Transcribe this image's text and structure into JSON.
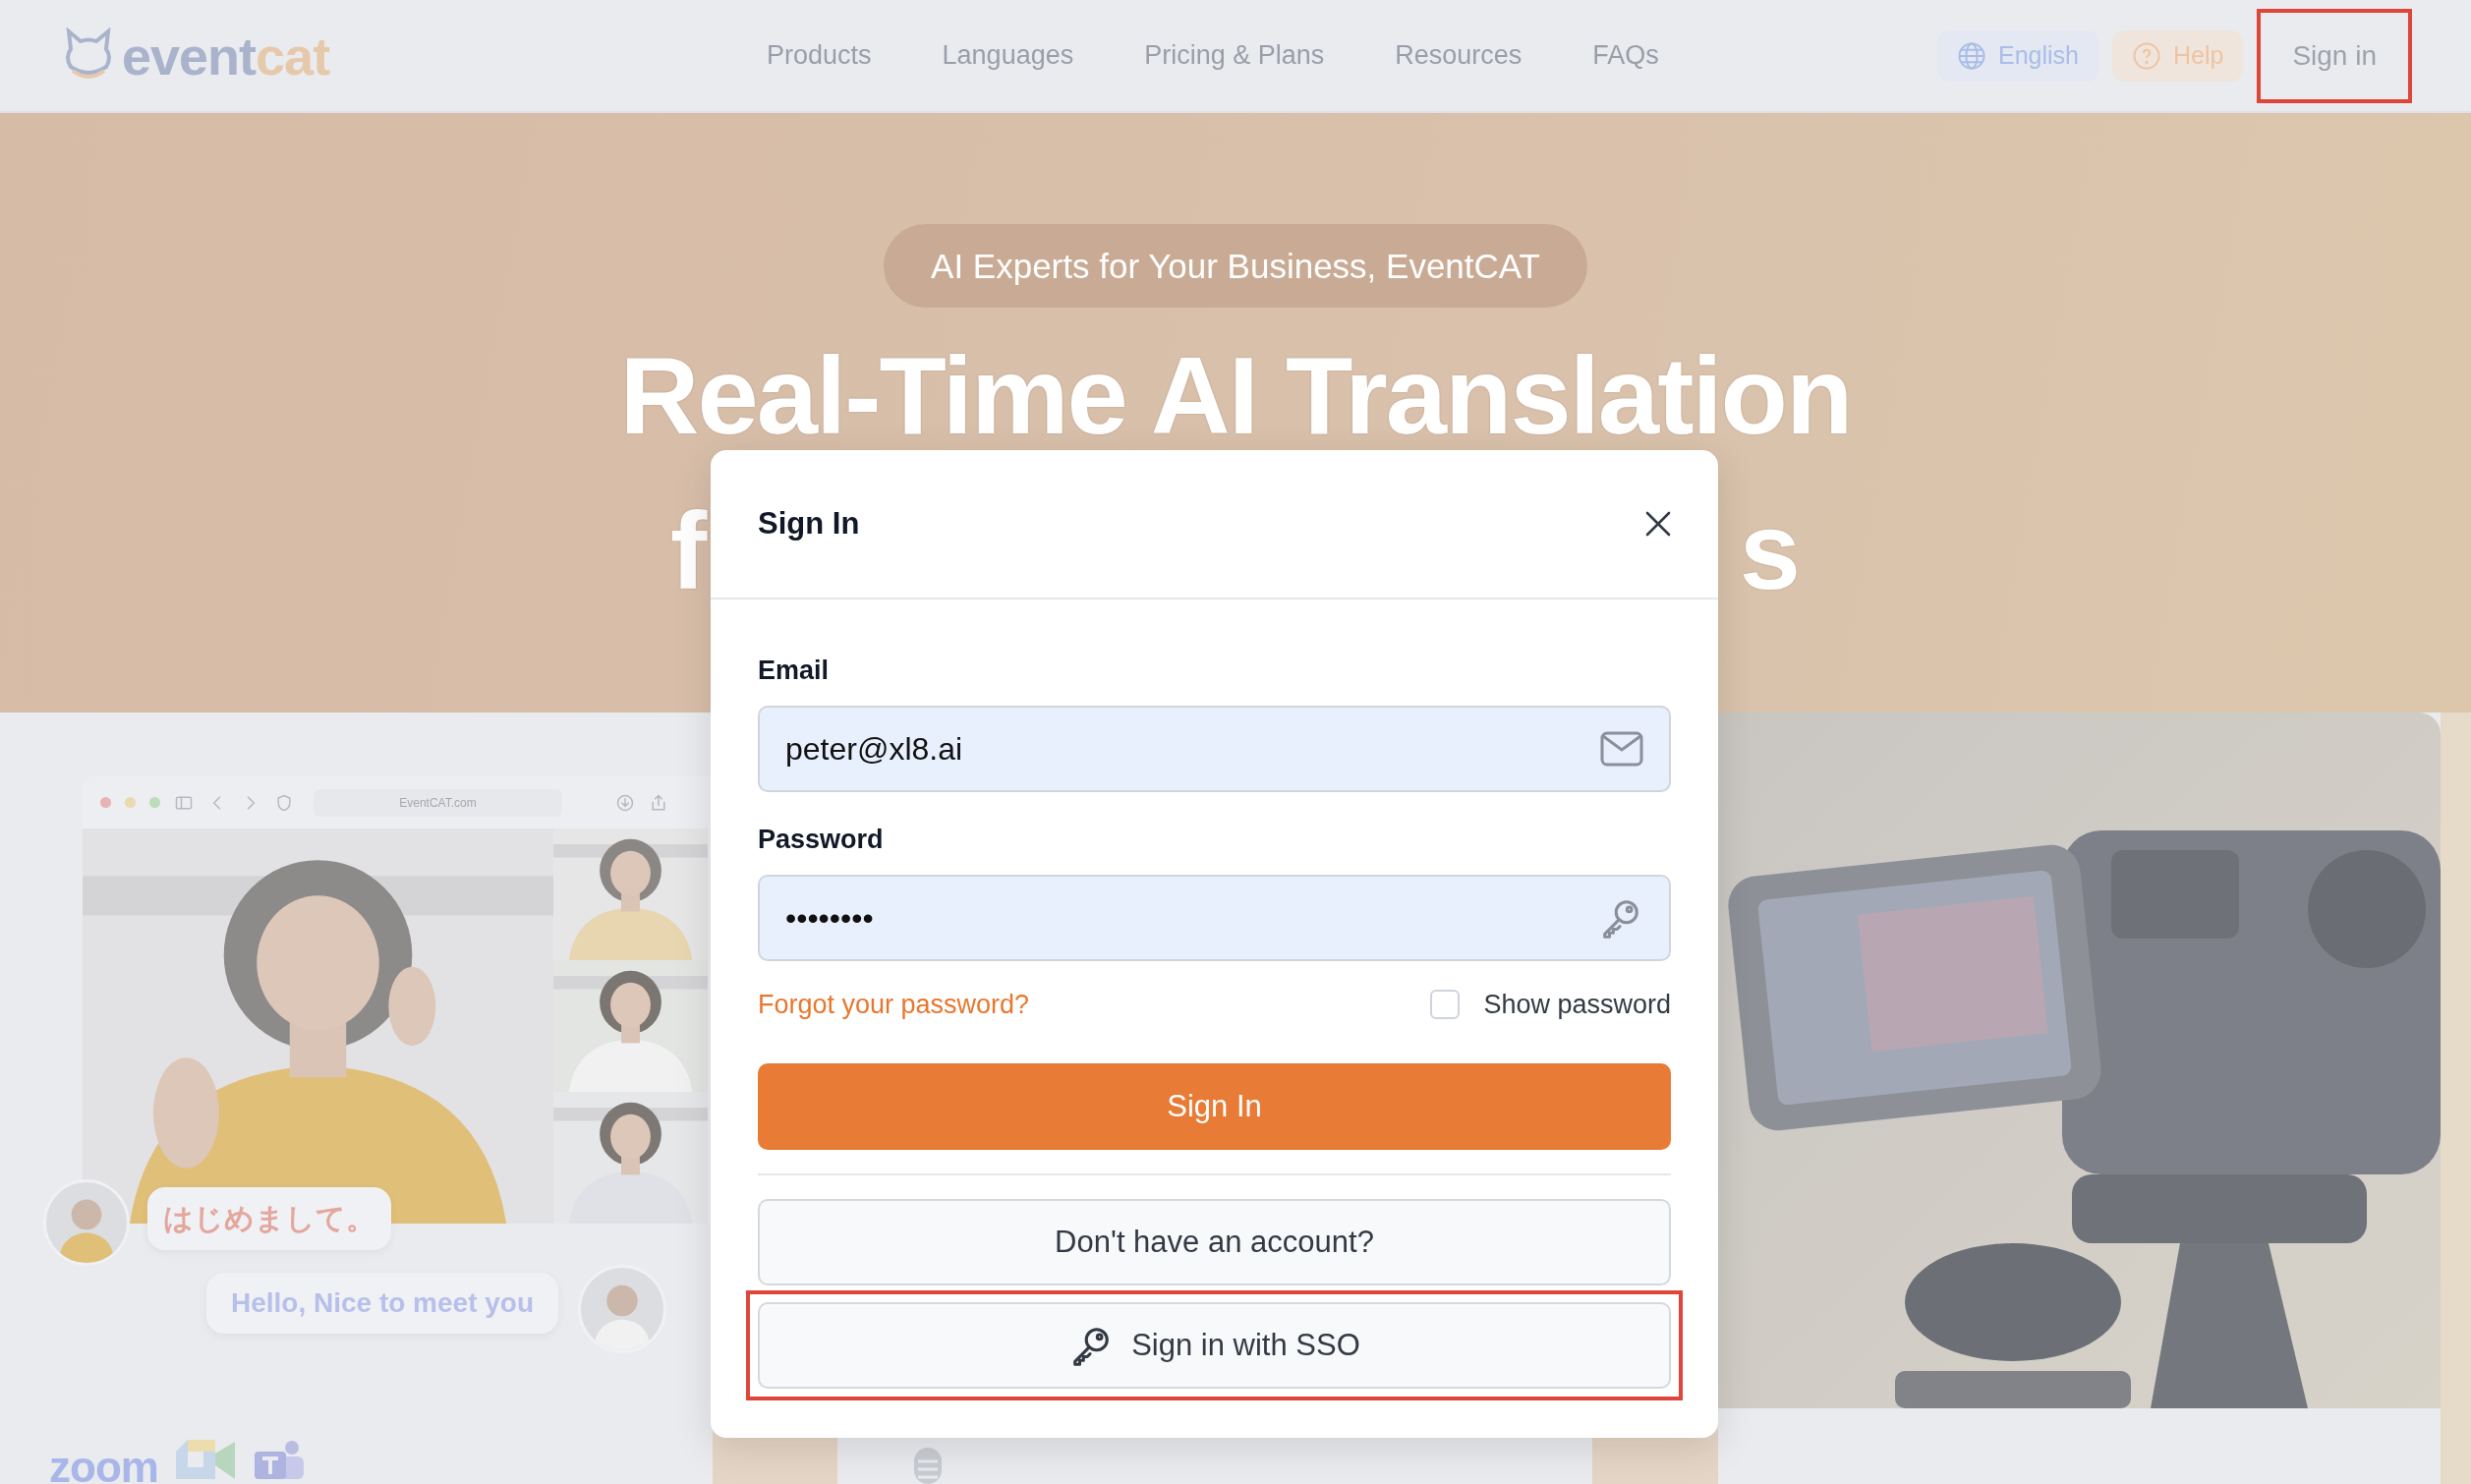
{
  "header": {
    "logo": {
      "first": "event",
      "second": "cat"
    },
    "nav": [
      "Products",
      "Languages",
      "Pricing & Plans",
      "Resources",
      "FAQs"
    ],
    "language": "English",
    "help": "Help",
    "sign_in": {
      "label": "Sign in",
      "highlighted": true
    }
  },
  "hero": {
    "tagline": "AI Experts for Your Business, EventCAT",
    "title_line_1": "Real-Time AI Translation",
    "title_line_2_fragments": [
      "f",
      "s"
    ]
  },
  "showcase": {
    "browser_url": "EventCAT.com",
    "messages": [
      {
        "text": "はじめまして。"
      },
      {
        "text": "Hello, Nice to meet you"
      }
    ],
    "partner_logo": "zoom"
  },
  "modal": {
    "title": "Sign In",
    "fields": [
      {
        "label": "Email",
        "value": "peter@xl8.ai",
        "kind": "email"
      },
      {
        "label": "Password",
        "value": "••••••••",
        "kind": "password"
      }
    ],
    "forgot_link": "Forgot your password?",
    "show_password": {
      "label": "Show password",
      "checked": false
    },
    "submit": "Sign In",
    "signup": "Don't have an account?",
    "sso": {
      "label": "Sign in with SSO",
      "highlighted": true
    }
  }
}
